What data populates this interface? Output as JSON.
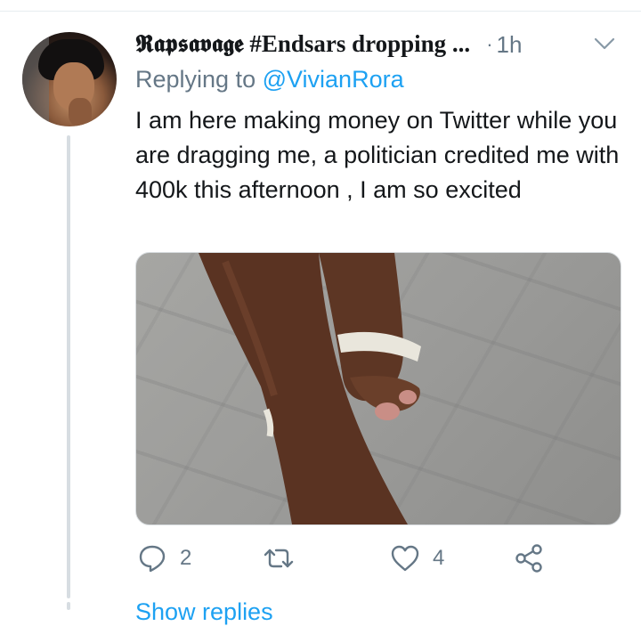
{
  "tweet": {
    "display_name": "𝕽𝖆𝖕𝖘𝖆𝖛𝖆𝖌𝖊 #Endsars dropping ...",
    "time_separator": "·",
    "time": "1h",
    "reply_prefix": "Replying to",
    "reply_handle": "@VivianRora",
    "text": "I am here making money on Twitter while you are dragging me, a politician credited me with 400k this afternoon , I am so excited"
  },
  "actions": {
    "reply_count": "2",
    "retweet_count": "",
    "like_count": "4"
  },
  "footer": {
    "show_replies": "Show replies"
  },
  "icons": {
    "menu": "chevron-down-icon",
    "reply": "reply-icon",
    "retweet": "retweet-icon",
    "like": "heart-icon",
    "share": "share-icon"
  },
  "colors": {
    "text": "#14171a",
    "secondary": "#657786",
    "link": "#1da1f2",
    "thread_line": "#d7dde2"
  }
}
